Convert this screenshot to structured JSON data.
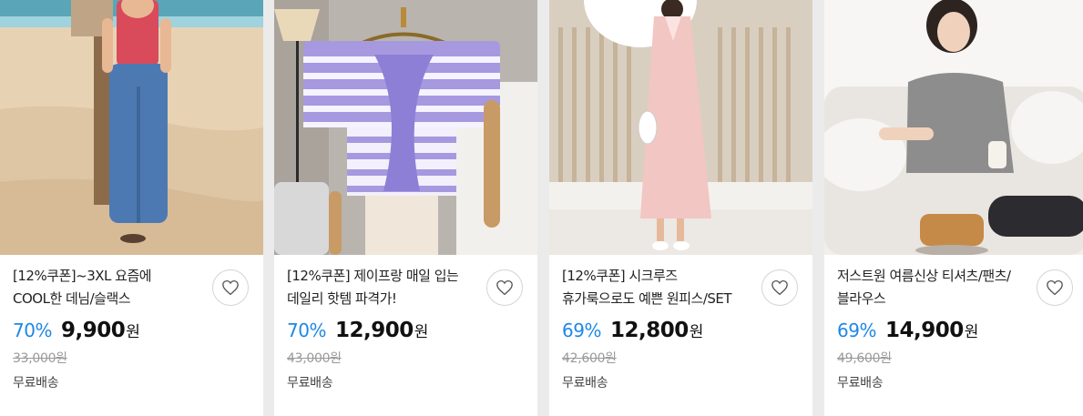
{
  "products": [
    {
      "title": "[12%쿠폰]~3XL 요즘에 COOL한 데님/슬랙스",
      "discount": "70%",
      "price": "9,900",
      "currency": "원",
      "original_price": "33,000원",
      "shipping": "무료배송",
      "wishlist_icon": "heart-icon"
    },
    {
      "title": "[12%쿠폰] 제이프랑 매일 입는 데일리 핫템 파격가!",
      "discount": "70%",
      "price": "12,900",
      "currency": "원",
      "original_price": "43,000원",
      "shipping": "무료배송",
      "wishlist_icon": "heart-icon"
    },
    {
      "title": "[12%쿠폰] 시크루즈 휴가룩으로도 예쁜 원피스/SET",
      "discount": "69%",
      "price": "12,800",
      "currency": "원",
      "original_price": "42,600원",
      "shipping": "무료배송",
      "wishlist_icon": "heart-icon"
    },
    {
      "title": "저스트원 여름신상 티셔츠/팬츠/블라우스",
      "discount": "69%",
      "price": "14,900",
      "currency": "원",
      "original_price": "49,600원",
      "shipping": "무료배송",
      "wishlist_icon": "heart-icon"
    }
  ],
  "colors": {
    "discount": "#1e88e5",
    "price": "#111111",
    "original_price": "#9a9a9a",
    "background": "#ebebeb"
  }
}
